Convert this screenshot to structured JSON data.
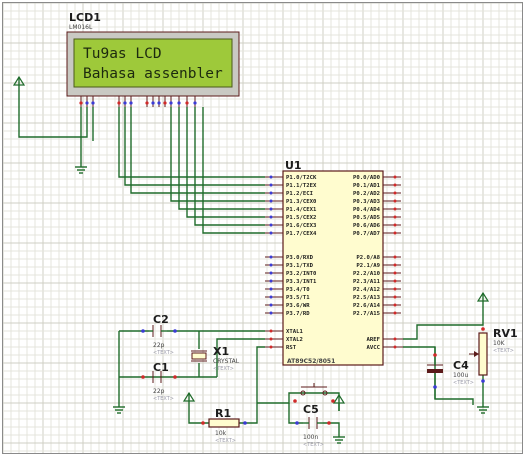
{
  "lcd": {
    "ref": "LCD1",
    "model": "LM016L",
    "line1": "Tu9as LCD",
    "line2": "Bahasa assenbler"
  },
  "mcu": {
    "ref": "U1",
    "model": "AT89C52/8051",
    "left_pins": [
      "P1.0/T2CK",
      "P1.1/T2EX",
      "P1.2/ECI",
      "P1.3/CEX0",
      "P1.4/CEX1",
      "P1.5/CEX2",
      "P1.6/CEX3",
      "P1.7/CEX4",
      "P3.0/RXD",
      "P3.1/TXD",
      "P3.2/INT0",
      "P3.3/INT1",
      "P3.4/T0",
      "P3.5/T1",
      "P3.6/WR",
      "P3.7/RD"
    ],
    "right_pins": [
      "P0.0/AD0",
      "P0.1/AD1",
      "P0.2/AD2",
      "P0.3/AD3",
      "P0.4/AD4",
      "P0.5/AD5",
      "P0.6/AD6",
      "P0.7/AD7",
      "P2.0/A8",
      "P2.1/A9",
      "P2.2/A10",
      "P2.3/A11",
      "P2.4/A12",
      "P2.5/A13",
      "P2.6/A14",
      "P2.7/A15"
    ],
    "xtal_pins": [
      "XTAL1",
      "XTAL2",
      "RST"
    ],
    "right_lower_pins": [
      "AREF",
      "AVCC"
    ]
  },
  "components": {
    "c2": {
      "ref": "C2",
      "value": "22p"
    },
    "c1": {
      "ref": "C1",
      "value": "22p"
    },
    "x1": {
      "ref": "X1",
      "value": "CRYSTAL"
    },
    "r1": {
      "ref": "R1",
      "value": "10k"
    },
    "c5": {
      "ref": "C5",
      "value": "100n"
    },
    "c4": {
      "ref": "C4",
      "value": "100u"
    },
    "rv1": {
      "ref": "RV1",
      "value": "10K"
    }
  },
  "ghost_text": "<TEXT>",
  "colors": {
    "grid_minor": "#e4e4dc",
    "grid_major": "#cfcfc4",
    "wire": "#1f6b2a",
    "lcd_screen": "#9ec93a",
    "body_fill": "#fffccf",
    "body_stroke": "#5b1a1a",
    "pin_red": "#d12a2a",
    "pin_blue": "#3b3bd6"
  }
}
